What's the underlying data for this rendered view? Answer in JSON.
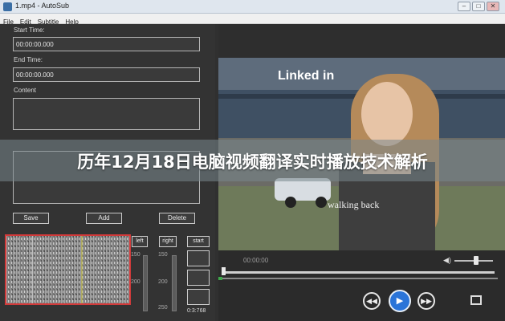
{
  "window": {
    "title": "1.mp4 - AutoSub"
  },
  "menu": [
    "File",
    "Edit",
    "Subtitle",
    "Help"
  ],
  "form": {
    "start_label": "Start Time:",
    "start_value": "00:00:00.000",
    "end_label": "End Time:",
    "end_value": "00:00:00.000",
    "content_label": "Content"
  },
  "actions": {
    "save": "Save",
    "add": "Add",
    "delete": "Delete"
  },
  "waveform_controls": {
    "left": "left",
    "right": "right",
    "start": "start",
    "left_scale": [
      "150",
      "200"
    ],
    "right_scale": [
      "150",
      "200",
      "250"
    ],
    "start_time": "0:3:768"
  },
  "video": {
    "sign_text": "Linked in",
    "subtitle": "walking back",
    "timecode": "00:00:00"
  },
  "overlay_banner": "历年12月18日电脑视频翻译实时播放技术解析",
  "colors": {
    "accent_play": "#2a74d8",
    "waveform_border": "#d23a3a"
  },
  "icons": [
    "app-icon",
    "minimize-icon",
    "maximize-icon",
    "close-icon",
    "volume-icon",
    "rewind-icon",
    "play-icon",
    "fast-forward-icon",
    "fullscreen-icon"
  ]
}
